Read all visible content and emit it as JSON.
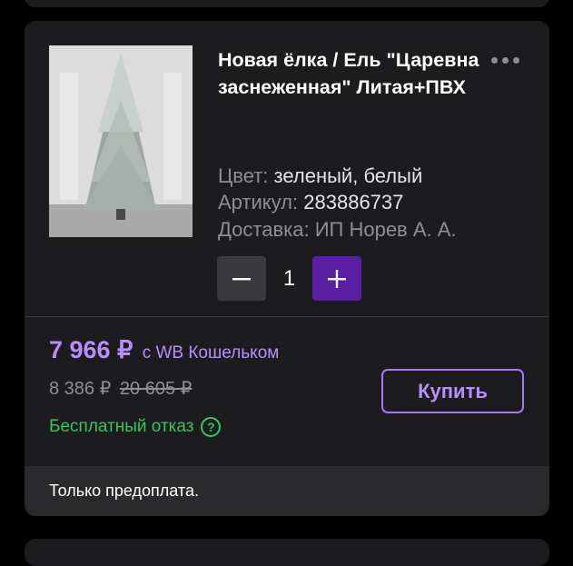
{
  "product": {
    "title": "Новая ёлка / Ель \"Царевна заснеженная\" Литая+ПВХ",
    "color_label": "Цвет:",
    "color_value": "зеленый, белый",
    "article_label": "Артикул:",
    "article_value": "283886737",
    "delivery_label": "Доставка:",
    "delivery_value": "ИП Норев А. А.",
    "image_icon": "christmas-tree-photo"
  },
  "stepper": {
    "minus": "−",
    "quantity": "1",
    "plus": "+"
  },
  "pricing": {
    "price": "7 966 ₽",
    "wallet_text": "с WB Кошельком",
    "regular_price": "8 386 ₽",
    "old_price": "20 605 ₽",
    "free_cancel": "Бесплатный отказ",
    "help_icon": "?"
  },
  "actions": {
    "buy_label": "Купить"
  },
  "footer": {
    "note": "Только предоплата."
  },
  "colors": {
    "accent": "#5b1fa6",
    "price": "#b98cff",
    "success": "#34c759",
    "card": "#1c1c1e"
  }
}
